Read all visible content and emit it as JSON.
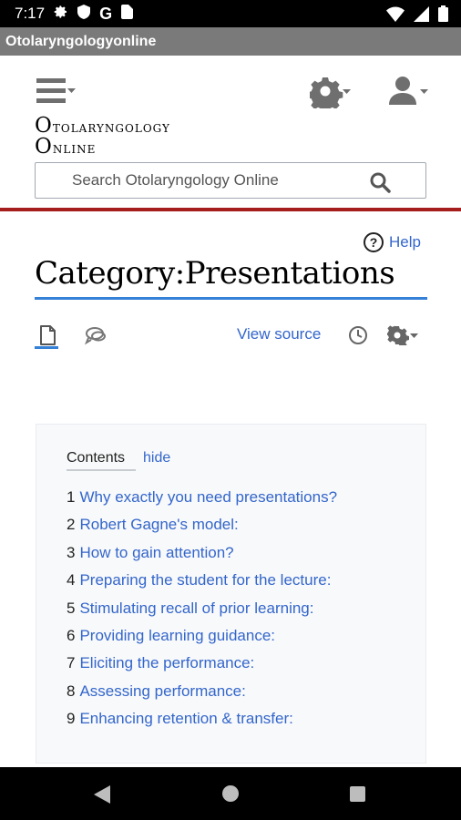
{
  "status_bar": {
    "time": "7:17"
  },
  "app_bar": {
    "title": "Otolaryngologyonline"
  },
  "header": {
    "logo_line1_cap": "O",
    "logo_line1_rest": "tolaryngology",
    "logo_line2_cap": "O",
    "logo_line2_rest": "nline",
    "search_placeholder": "Search Otolaryngology Online"
  },
  "page": {
    "help_label": "Help",
    "title": "Category:Presentations",
    "view_source_label": "View source"
  },
  "toc": {
    "heading": "Contents",
    "hide_label": "hide",
    "items": [
      {
        "num": "1",
        "text": "Why exactly you need presentations?"
      },
      {
        "num": "2",
        "text": "Robert Gagne's model:"
      },
      {
        "num": "3",
        "text": "How to gain attention?"
      },
      {
        "num": "4",
        "text": "Preparing the student for the lecture:"
      },
      {
        "num": "5",
        "text": "Stimulating recall of prior learning:"
      },
      {
        "num": "6",
        "text": "Providing learning guidance:"
      },
      {
        "num": "7",
        "text": "Eliciting the performance:"
      },
      {
        "num": "8",
        "text": "Assessing performance:"
      },
      {
        "num": "9",
        "text": "Enhancing retention & transfer:"
      }
    ]
  },
  "icons": {
    "status": [
      "gear-icon",
      "shield-icon",
      "google-g-icon",
      "sim-card-icon",
      "wifi-icon",
      "signal-icon",
      "battery-icon"
    ],
    "header": [
      "menu-icon",
      "settings-icon",
      "user-icon",
      "search-icon"
    ],
    "toolbar": [
      "page-icon",
      "talk-icon",
      "history-icon",
      "more-gear-icon"
    ],
    "nav": [
      "back-icon",
      "home-icon",
      "recents-icon"
    ]
  },
  "colors": {
    "accent_link": "#3366cc",
    "title_underline": "#3681d8",
    "header_rule": "#a51d1d",
    "app_bar": "#7a7a7a"
  }
}
